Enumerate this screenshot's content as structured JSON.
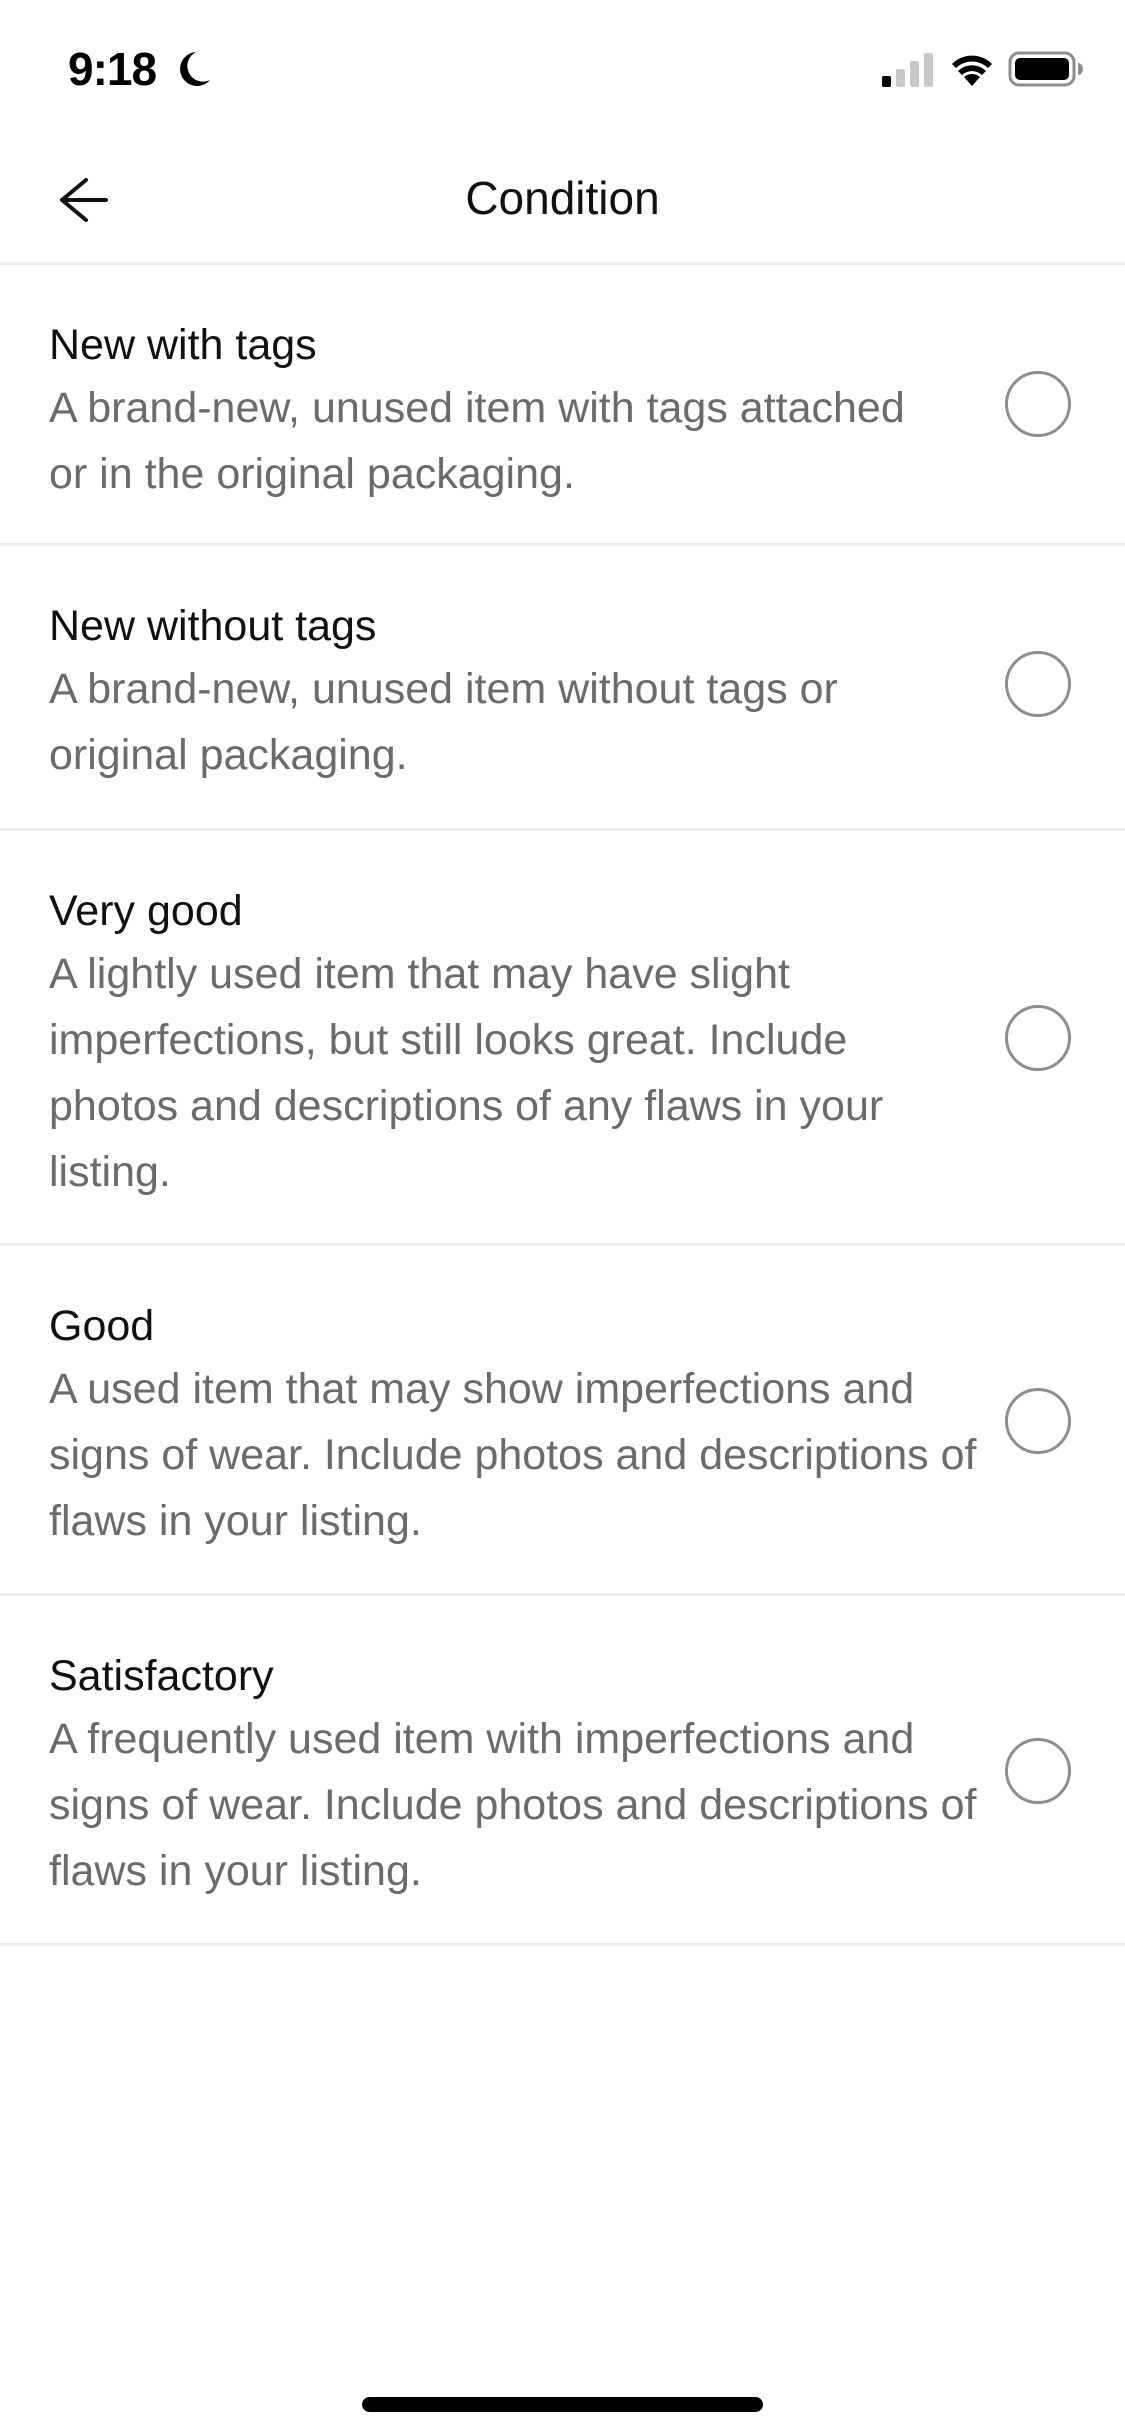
{
  "status_bar": {
    "time": "9:18",
    "focus_icon": "moon-icon",
    "signal_icon": "cellular-signal-icon",
    "signal_bars_active": 1,
    "signal_bars_total": 4,
    "wifi_icon": "wifi-icon",
    "battery_icon": "battery-icon",
    "battery_level": 0.85
  },
  "header": {
    "back_icon": "arrow-left-icon",
    "title": "Condition"
  },
  "options": [
    {
      "title": "New with tags",
      "description": "A brand-new, unused item with tags attached or in the original packaging.",
      "selected": false
    },
    {
      "title": "New without tags",
      "description": "A brand-new, unused item without tags or original packaging.",
      "selected": false
    },
    {
      "title": "Very good",
      "description": "A lightly used item that may have slight imperfections, but still looks great. Include photos and descriptions of any flaws in your listing.",
      "selected": false
    },
    {
      "title": "Good",
      "description": "A used item that may show imperfections and signs of wear. Include photos and descriptions of flaws in your listing.",
      "selected": false
    },
    {
      "title": "Satisfactory",
      "description": "A frequently used item with imperfections and signs of wear. Include photos and descriptions of flaws in your listing.",
      "selected": false
    }
  ],
  "colors": {
    "text_primary": "#111111",
    "text_secondary": "#6b6b6b",
    "divider": "#ececec",
    "radio_border": "#8e8e8e"
  }
}
